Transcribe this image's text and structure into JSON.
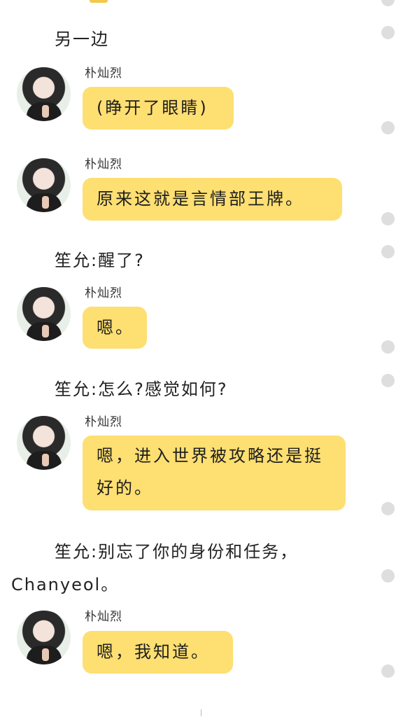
{
  "section_heading": "另一边",
  "messages": [
    {
      "speaker": "朴灿烈",
      "text": "(睁开了眼睛)"
    },
    {
      "speaker": "朴灿烈",
      "text": "原来这就是言情部王牌。"
    },
    {
      "speaker": "朴灿烈",
      "text": "嗯。"
    },
    {
      "speaker": "朴灿烈",
      "text": "嗯，进入世界被攻略还是挺好的。"
    },
    {
      "speaker": "朴灿烈",
      "text": "嗯，我知道。"
    }
  ],
  "narration": [
    "笙允:醒了?",
    "笙允:怎么?感觉如何?",
    "笙允:别忘了你的身份和任务，",
    "Chanyeol。"
  ],
  "colors": {
    "bubble": "#fddf72",
    "rail_dot": "#dedede",
    "background": "#ffffff"
  },
  "icons": {
    "avatar": "user-avatar-photo",
    "rail_dot": "dot-icon"
  }
}
